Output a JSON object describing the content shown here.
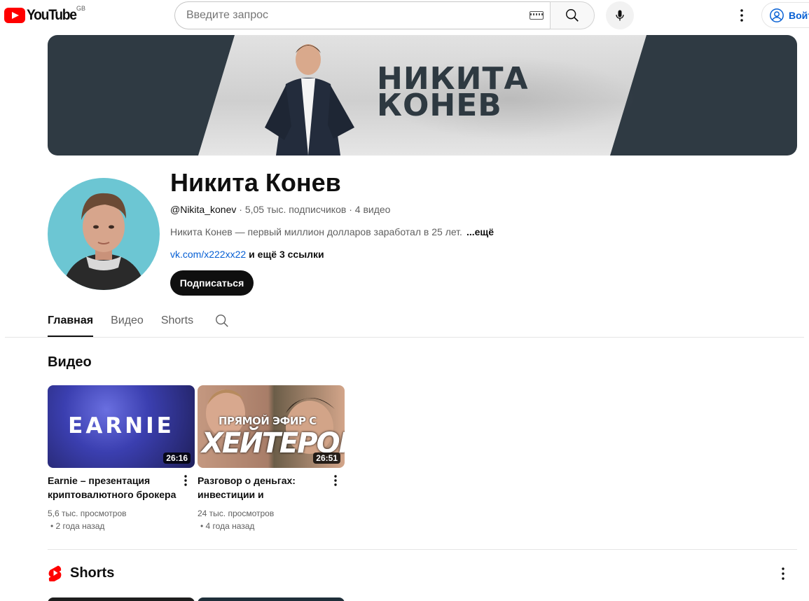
{
  "header": {
    "logo_text": "YouTube",
    "region": "GB",
    "search_placeholder": "Введите запрос",
    "signin_label": "Войти"
  },
  "banner": {
    "line1": "НИКИТА",
    "line2": "КОНЕВ"
  },
  "channel": {
    "name": "Никита Конев",
    "handle": "@Nikita_konev",
    "subscribers": "5,05 тыс. подписчиков",
    "video_count": "4 видео",
    "separator": " · ",
    "description": "Никита Конев — первый миллион долларов заработал в 25 лет.",
    "more_label": "...ещё",
    "link": "vk.com/x222xx22",
    "more_links": "и ещё 3 ссылки",
    "subscribe_label": "Подписаться"
  },
  "tabs": [
    {
      "label": "Главная",
      "active": true
    },
    {
      "label": "Видео",
      "active": false
    },
    {
      "label": "Shorts",
      "active": false
    }
  ],
  "videos_section": {
    "title": "Видео",
    "items": [
      {
        "thumb_text": "EARNIE",
        "duration": "26:16",
        "title": "Earnie – презентация криптовалютного брокера",
        "views": "5,6 тыс. просмотров",
        "age": "• 2 года назад"
      },
      {
        "thumb_text_1": "ПРЯМОЙ ЭФИР С",
        "thumb_text_2": "ХЕЙТЕРОМ",
        "duration": "26:51",
        "title": "Разговор о деньгах: инвестиции и финансовая…",
        "views": "24 тыс. просмотров",
        "age": "• 4 года назад"
      }
    ]
  },
  "shorts_section": {
    "title": "Shorts"
  },
  "colors": {
    "brand_red": "#ff0000",
    "link_blue": "#065fd4",
    "text_primary": "#0f0f0f",
    "text_secondary": "#606060",
    "banner_dark": "#2f3a43"
  }
}
